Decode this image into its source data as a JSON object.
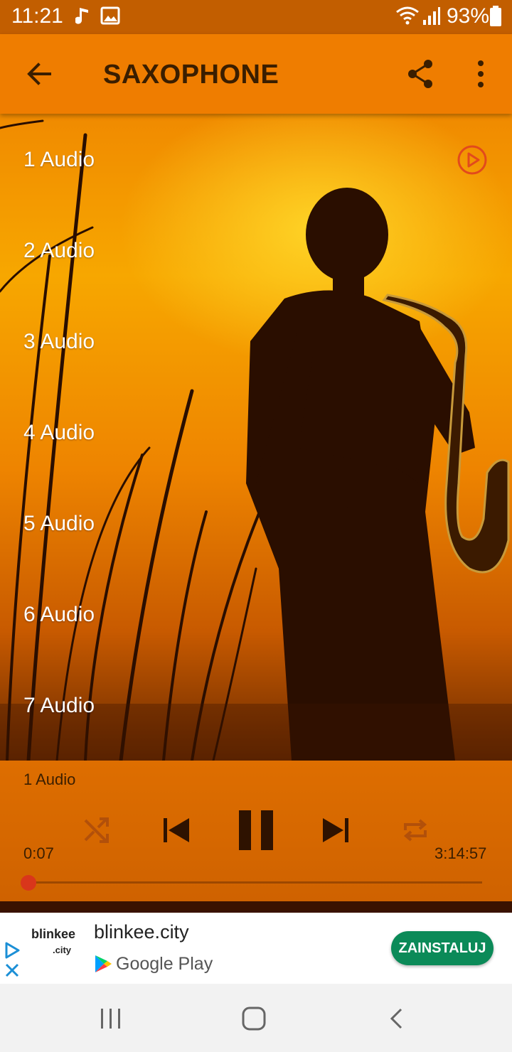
{
  "status_bar": {
    "time": "11:21",
    "battery": "93%",
    "icons": [
      "music-note-icon",
      "image-icon",
      "wifi-icon",
      "signal-icon",
      "battery-icon"
    ]
  },
  "app_bar": {
    "title": "SAXOPHONE",
    "icons": [
      "back-arrow-icon",
      "share-icon",
      "more-vert-icon"
    ]
  },
  "tracks": [
    "1 Audio",
    "2 Audio",
    "3 Audio",
    "4 Audio",
    "5 Audio",
    "6 Audio",
    "7 Audio"
  ],
  "player": {
    "now_playing": "1 Audio",
    "elapsed": "0:07",
    "duration": "3:14:57",
    "progress_fraction": 0.0,
    "controls": [
      "shuffle-icon",
      "previous-icon",
      "pause-icon",
      "next-icon",
      "repeat-icon"
    ]
  },
  "ad": {
    "advertiser": "blinkee.city",
    "logo_text": "blinkee",
    "logo_subtext": ".city",
    "store": "Google Play",
    "cta": "ZAINSTALUJ"
  },
  "colors": {
    "app_bar": "#ef7d00",
    "status_bar": "#c25e00",
    "accent": "#d9361b",
    "cta": "#0b8a58"
  }
}
